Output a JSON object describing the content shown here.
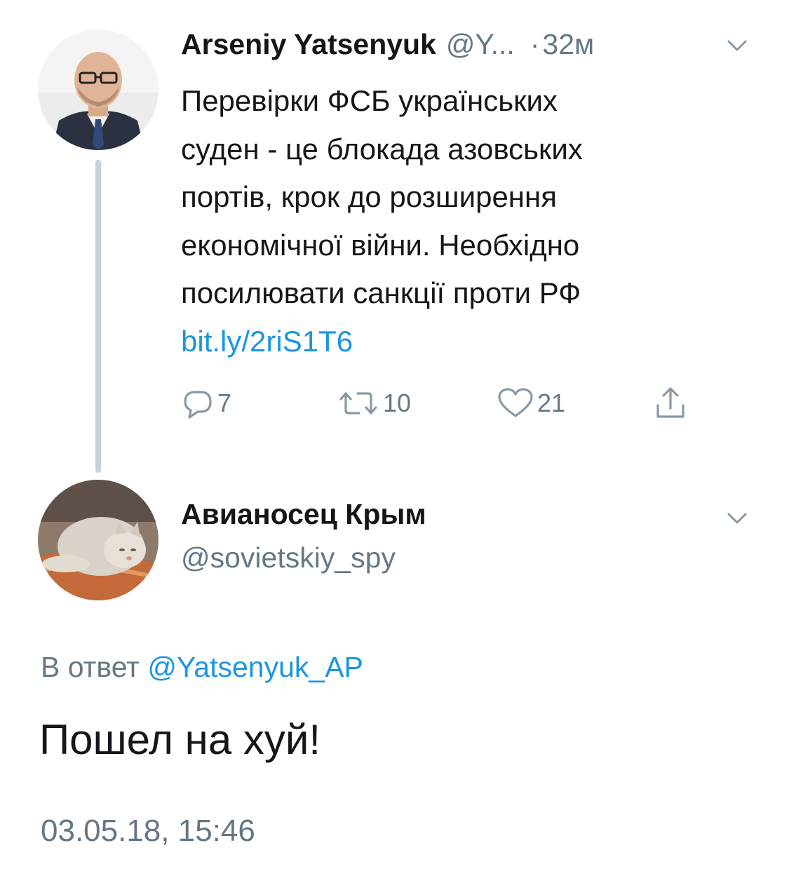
{
  "parent_tweet": {
    "author_name": "Arseniy Yatsenyuk",
    "author_handle": "@Y...",
    "separator": "·",
    "time_ago": "32м",
    "text_lines": [
      "Перевірки ФСБ українських",
      "суден - це блокада азовських",
      "портів, крок до розширення",
      "економічної війни. Необхідно",
      "посилювати санкції проти РФ"
    ],
    "link": "bit.ly/2riS1T6",
    "actions": {
      "reply_count": "7",
      "retweet_count": "10",
      "like_count": "21"
    }
  },
  "reply_tweet": {
    "author_name": "Авианосец Крым",
    "author_handle": "@sovietskiy_spy",
    "reply_to_prefix": "В ответ",
    "reply_to_handle": "@Yatsenyuk_AP",
    "text": "Пошел на хуй!",
    "timestamp": "03.05.18, 15:46"
  },
  "colors": {
    "text": "#14171a",
    "secondary": "#657786",
    "link": "#1b95e0",
    "thread_line": "#c6d1da"
  }
}
